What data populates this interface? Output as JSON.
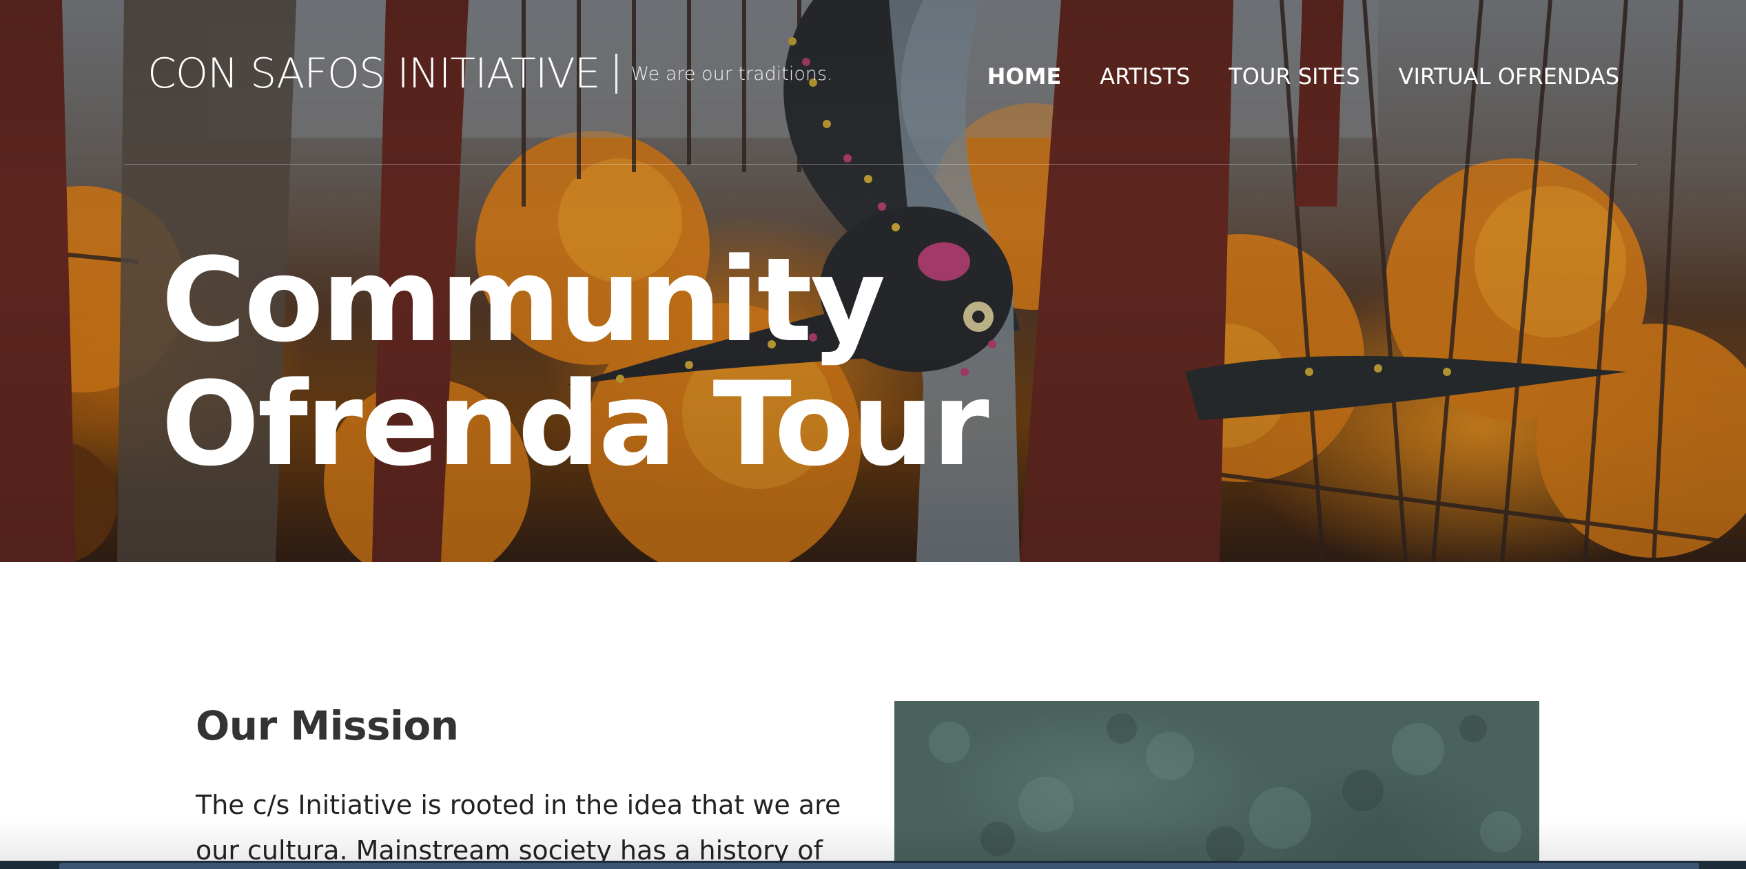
{
  "site": {
    "title": "CON SAFOS INITIATIVE",
    "tagline": "We are our traditions."
  },
  "nav": {
    "items": [
      {
        "label": "HOME",
        "active": true
      },
      {
        "label": "ARTISTS",
        "active": false
      },
      {
        "label": "TOUR SITES",
        "active": false
      },
      {
        "label": "VIRTUAL OFRENDAS",
        "active": false
      }
    ]
  },
  "hero": {
    "heading_line1": "Community",
    "heading_line2": "Ofrenda Tour"
  },
  "mission": {
    "title": "Our Mission",
    "body": "The c/s Initiative is rooted in the idea that we are our cultura. Mainstream society has a history of"
  },
  "colors": {
    "marigold": "#e98a1c",
    "text_dark": "#333333",
    "photo_teal": "#4a625d"
  }
}
